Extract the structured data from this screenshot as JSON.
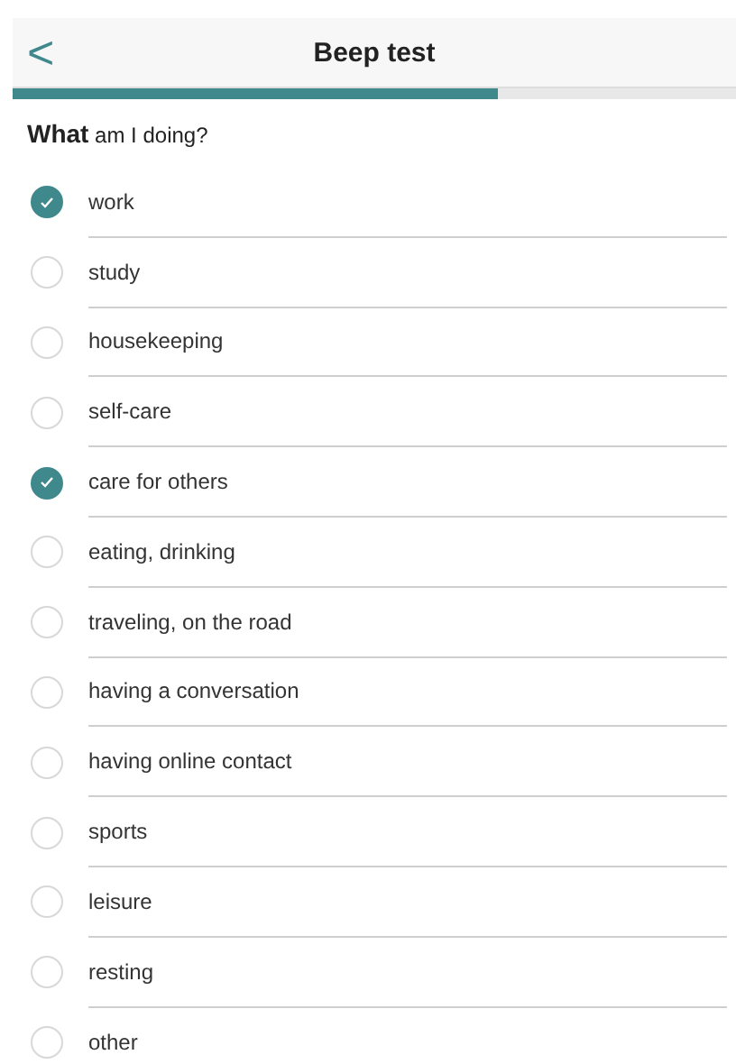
{
  "header": {
    "back": "<",
    "title": "Beep test"
  },
  "progress": {
    "level": 0.67
  },
  "question": "**What** am I doing?",
  "options": [
    {
      "label": "work",
      "checked": true
    },
    {
      "label": "study",
      "checked": false
    },
    {
      "label": "housekeeping",
      "checked": false
    },
    {
      "label": "self-care",
      "checked": false
    },
    {
      "label": "care for others",
      "checked": true
    },
    {
      "label": "eating, drinking",
      "checked": false
    },
    {
      "label": "traveling, on the road",
      "checked": false
    },
    {
      "label": "having a conversation",
      "checked": false
    },
    {
      "label": "having online contact",
      "checked": false
    },
    {
      "label": "sports",
      "checked": false
    },
    {
      "label": "leisure",
      "checked": false
    },
    {
      "label": "resting",
      "checked": false
    },
    {
      "label": "other",
      "checked": false
    }
  ]
}
